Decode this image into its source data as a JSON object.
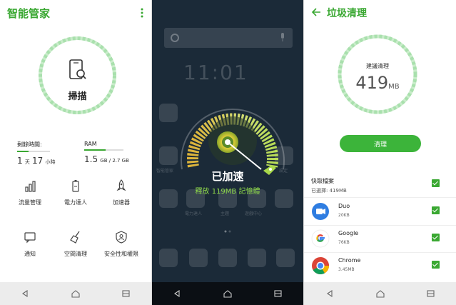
{
  "panel1": {
    "title": "智能管家",
    "scan_label": "掃描",
    "battery_label": "剩餘時間:",
    "battery_value_days": "1",
    "battery_days_unit": "天",
    "battery_value_hours": "17",
    "battery_hours_unit": "小時",
    "battery_fraction": 0.35,
    "ram_label": "RAM",
    "ram_used": "1.5",
    "ram_total_text": "GB / 2.7 GB",
    "ram_fraction": 0.55,
    "tools": [
      {
        "label": "流量管理",
        "icon": "data-usage-icon"
      },
      {
        "label": "電力達人",
        "icon": "battery-icon"
      },
      {
        "label": "加速器",
        "icon": "rocket-icon"
      },
      {
        "label": "通知",
        "icon": "notification-icon"
      },
      {
        "label": "空間清理",
        "icon": "broom-icon"
      },
      {
        "label": "安全性和權限",
        "icon": "shield-user-icon"
      }
    ]
  },
  "panel2": {
    "clock": "11:01",
    "status_title": "已加速",
    "freed_text": "釋放 119MB 記憶體",
    "dim_labels": [
      "智能管家",
      "電力達人",
      "主題",
      "遊戲中心",
      "Google",
      "設定"
    ]
  },
  "panel3": {
    "title": "垃圾清理",
    "suggest_label": "建議清理",
    "size_value": "419",
    "size_unit": "MB",
    "clean_button": "清理",
    "section_title": "快取檔案",
    "selected_text": "已選擇: 419MB",
    "apps": [
      {
        "name": "Duo",
        "size": "20KB",
        "icon": "duo-icon",
        "checked": true
      },
      {
        "name": "Google",
        "size": "76KB",
        "icon": "google-icon",
        "checked": true
      },
      {
        "name": "Chrome",
        "size": "3.45MB",
        "icon": "chrome-icon",
        "checked": true
      }
    ]
  },
  "colors": {
    "accent": "#3aa832",
    "ring": "#a9e0ad",
    "button": "#3cb43a",
    "dark_bg": "#1b2a38"
  }
}
